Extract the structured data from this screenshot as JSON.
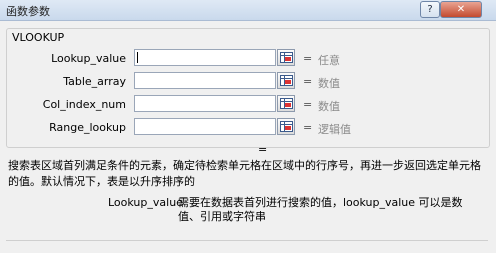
{
  "window": {
    "title": "函数参数",
    "help_glyph": "?",
    "close_glyph": "✕"
  },
  "function_name": "VLOOKUP",
  "args": [
    {
      "label": "Lookup_value",
      "value": "",
      "eq": "=",
      "hint": "任意"
    },
    {
      "label": "Table_array",
      "value": "",
      "eq": "=",
      "hint": "数值"
    },
    {
      "label": "Col_index_num",
      "value": "",
      "eq": "=",
      "hint": "数值"
    },
    {
      "label": "Range_lookup",
      "value": "",
      "eq": "=",
      "hint": "逻辑值"
    }
  ],
  "result_eq": "=",
  "description": "搜索表区域首列满足条件的元素，确定待检索单元格在区域中的行序号，再进一步返回选定单元格的值。默认情况下，表是以升序排序的",
  "arg_help": {
    "name": "Lookup_value",
    "text": "需要在数据表首列进行搜索的值，lookup_value 可以是数值、引用或字符串"
  }
}
